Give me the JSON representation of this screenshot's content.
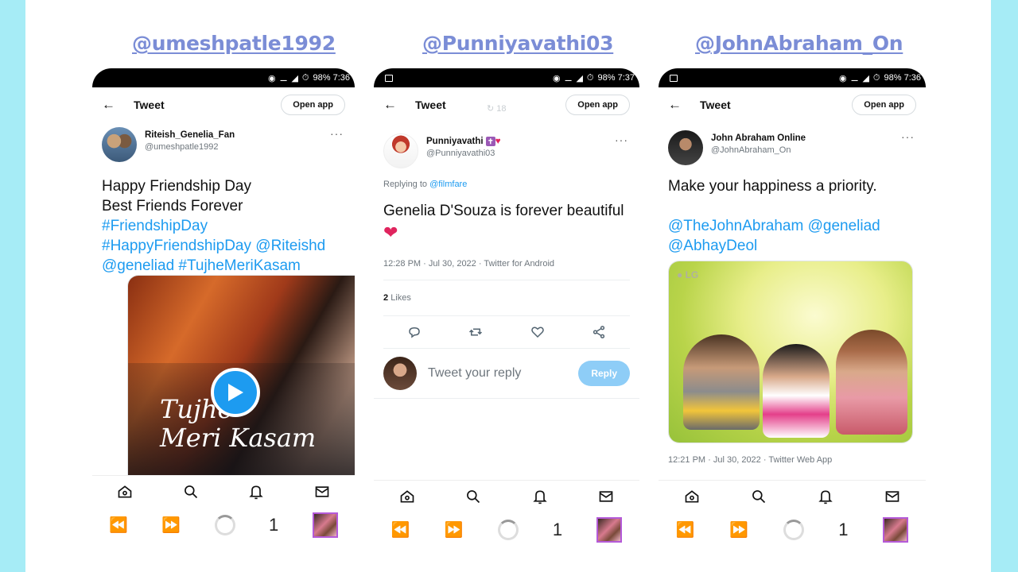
{
  "handles": [
    "@umeshpatle1992",
    "@Punniyavathi03",
    "@JohnAbraham_On"
  ],
  "common": {
    "status_text": "98% 7:36",
    "status_text_2": "98% 7:37",
    "page_title": "Tweet",
    "open_app": "Open app",
    "tab_count": "1"
  },
  "phone1": {
    "display_name": "Riteish_Genelia_Fan",
    "username": "@umeshpatle1992",
    "line1": "Happy Friendship Day",
    "line2": "Best Friends Forever",
    "tag1": "#FriendshipDay",
    "tag2": "#HappyFriendshipDay",
    "mention1": "@Riteishd",
    "mention2": "@geneliad",
    "tag3": "#TujheMeriKasam",
    "video_title_1": "Tujhe",
    "video_title_2": "Meri Kasam"
  },
  "phone2": {
    "display_name": "Punniyavathi",
    "username": "@Punniyavathi03",
    "replying_prefix": "Replying to",
    "replying_to": "@filmfare",
    "tweet_text": "Genelia D'Souza is forever beautiful",
    "timestamp": "12:28 PM · Jul 30, 2022 · Twitter for Android",
    "likes_count": "2",
    "likes_label": "Likes",
    "reply_placeholder": "Tweet your reply",
    "reply_button": "Reply",
    "behind_count": "18"
  },
  "phone3": {
    "display_name": "John Abraham Online",
    "username": "@JohnAbraham_On",
    "tweet_text": "Make your happiness a priority.",
    "mention1": "@TheJohnAbraham",
    "mention2": "@geneliad",
    "mention3": "@AbhayDeol",
    "image_brand": "LG",
    "timestamp": "12:21 PM · Jul 30, 2022 · Twitter Web App"
  },
  "colors": {
    "accent": "#1d9bf0",
    "handle": "#7b8dd6",
    "frame": "#a6ecf6",
    "heart": "#e0245e"
  },
  "icons": {
    "nav": [
      "home-icon",
      "search-icon",
      "bell-icon",
      "mail-icon"
    ],
    "actions": [
      "reply-icon",
      "retweet-icon",
      "like-icon",
      "share-icon"
    ]
  }
}
